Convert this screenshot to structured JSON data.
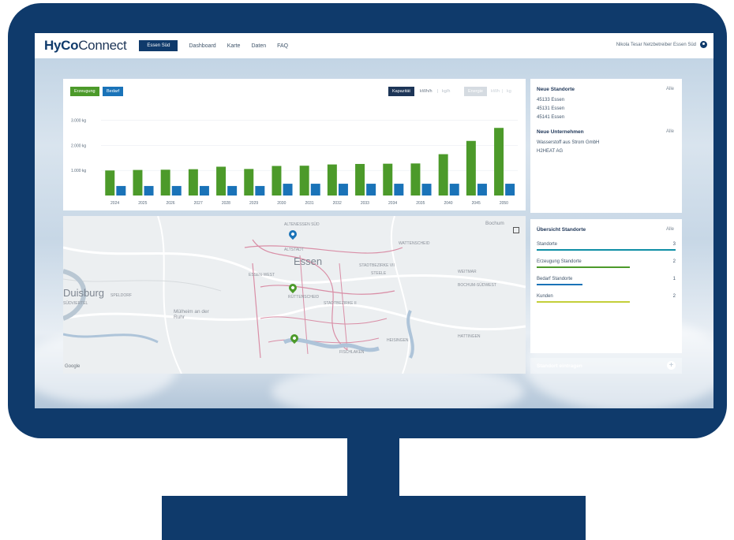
{
  "nav": {
    "logo_bold": "HyCo",
    "logo_rest": "Connect",
    "site_button": "Essen Süd",
    "links": [
      "Dashboard",
      "Karte",
      "Daten",
      "FAQ"
    ],
    "user": "Nikola Tesar Netzbetreiber Essen Süd"
  },
  "chart": {
    "toggle_production": "Erzeugung",
    "toggle_demand": "Bedarf",
    "unit_capacity": "Kapazität",
    "unit_kwh": "kWh/h",
    "unit_kgh": "kg/h",
    "unit_energy": "Energie",
    "unit_kwh2": "kWh",
    "unit_kg": "kg"
  },
  "chart_data": {
    "type": "bar",
    "categories": [
      "2024",
      "2025",
      "2026",
      "2027",
      "2028",
      "2029",
      "2030",
      "2031",
      "2032",
      "2033",
      "2034",
      "2035",
      "2040",
      "2045",
      "2050"
    ],
    "series": [
      {
        "name": "Erzeugung",
        "values": [
          1000,
          1020,
          1030,
          1050,
          1150,
          1060,
          1180,
          1190,
          1240,
          1260,
          1270,
          1280,
          1650,
          2180,
          2700
        ]
      },
      {
        "name": "Bedarf",
        "values": [
          380,
          380,
          380,
          380,
          380,
          380,
          470,
          470,
          470,
          470,
          470,
          470,
          470,
          470,
          470
        ]
      }
    ],
    "yticks": [
      "3.000 kg",
      "2.000 kg",
      "1.000 kg"
    ],
    "ytick_values": [
      3000,
      2000,
      1000
    ],
    "ylim": [
      0,
      3400
    ],
    "colors": {
      "production": "#4c9a2a",
      "demand": "#1a73b8"
    }
  },
  "map": {
    "city": "Essen",
    "city2": "Duisburg",
    "city3": "Mülheim an der Ruhr",
    "city4": "Bochum",
    "labels": [
      "ALTENESSEN SÜD",
      "WATTENSCHEID",
      "STADTBEZIRKE VII",
      "ESSEN-WEST",
      "ALTSTADT",
      "STADTBEZIRKE II",
      "WEITMAR",
      "BOCHUM-SÜDWEST",
      "SPELDORF",
      "HATTINGEN",
      "FISCHLAKEN",
      "HEISINGEN",
      "SÜDVIERTEL",
      "RÜTTENSCHEID",
      "STEELE"
    ],
    "google": "Google"
  },
  "new_sites": {
    "title": "Neue Standorte",
    "all": "Alle",
    "items": [
      "45133 Essen",
      "45131 Essen",
      "45141 Essen"
    ]
  },
  "new_companies": {
    "title": "Neue Unternehmen",
    "all": "Alle",
    "items": [
      "Wasserstoff aus Strom GmbH",
      "H2HEAT AG"
    ]
  },
  "overview": {
    "title": "Übersicht Standorte",
    "all": "Alle",
    "rows": [
      {
        "label": "Standorte",
        "value": "3",
        "color": "#0f8fa6",
        "fill": 1.0
      },
      {
        "label": "Erzeugung Standorte",
        "value": "2",
        "color": "#4c9a2a",
        "fill": 0.67
      },
      {
        "label": "Bedarf Standorte",
        "value": "1",
        "color": "#1a73b8",
        "fill": 0.33
      },
      {
        "label": "Kunden",
        "value": "2",
        "color": "#c3cf3a",
        "fill": 0.67
      }
    ]
  },
  "add_site": {
    "label": "Standort eintragen"
  }
}
